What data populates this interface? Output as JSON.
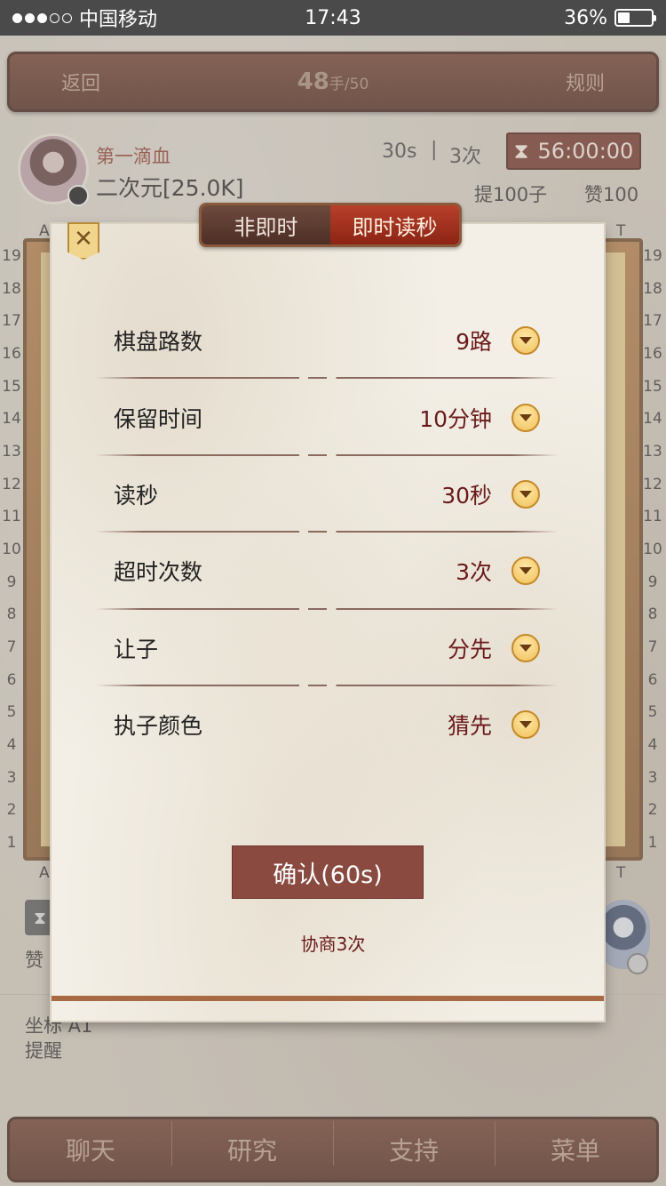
{
  "status_bar": {
    "carrier": "中国移动",
    "time": "17:43",
    "battery": "36%",
    "battery_level": 0.36
  },
  "header": {
    "back": "返回",
    "moves_current": "48",
    "moves_unit": "手",
    "moves_total": "/50",
    "rules": "规则"
  },
  "player_top": {
    "title": "第一滴血",
    "name": "二次元[25.0K]",
    "time": "30s",
    "separator": "|",
    "count": "3次",
    "timer": "56:00:00",
    "captures": "提100子",
    "likes": "赞100"
  },
  "board": {
    "rows_left": [
      "19",
      "18",
      "17",
      "16",
      "15",
      "14",
      "13",
      "12",
      "11",
      "10",
      "9",
      "8",
      "7",
      "6",
      "5",
      "4",
      "3",
      "2",
      "1"
    ],
    "rows_right": [
      "19",
      "18",
      "17",
      "16",
      "15",
      "14",
      "13",
      "12",
      "11",
      "10",
      "9",
      "8",
      "7",
      "6",
      "5",
      "4",
      "3",
      "2",
      "1"
    ],
    "col_a_top": "A",
    "col_t_top": "T",
    "col_a_bottom": "A",
    "col_t_bottom": "T"
  },
  "player_bottom": {
    "likes": "赞",
    "coord": "坐标 A1",
    "reminder": "提醒"
  },
  "nav": [
    "聊天",
    "研究",
    "支持",
    "菜单"
  ],
  "modal": {
    "close_glyph": "✕",
    "tabs": {
      "non_realtime": "非即时",
      "realtime": "即时读秒"
    },
    "settings": [
      {
        "label": "棋盘路数",
        "value": "9路"
      },
      {
        "label": "保留时间",
        "value": "10分钟"
      },
      {
        "label": "读秒",
        "value": "30秒"
      },
      {
        "label": "超时次数",
        "value": "3次"
      },
      {
        "label": "让子",
        "value": "分先"
      },
      {
        "label": "执子颜色",
        "value": "猜先"
      }
    ],
    "confirm": "确认(60s)",
    "negotiate": "协商3次"
  },
  "colors": {
    "accent_red": "#8c2414",
    "bar_brown": "#4e2418",
    "confirm_bg": "#8a4a40"
  }
}
